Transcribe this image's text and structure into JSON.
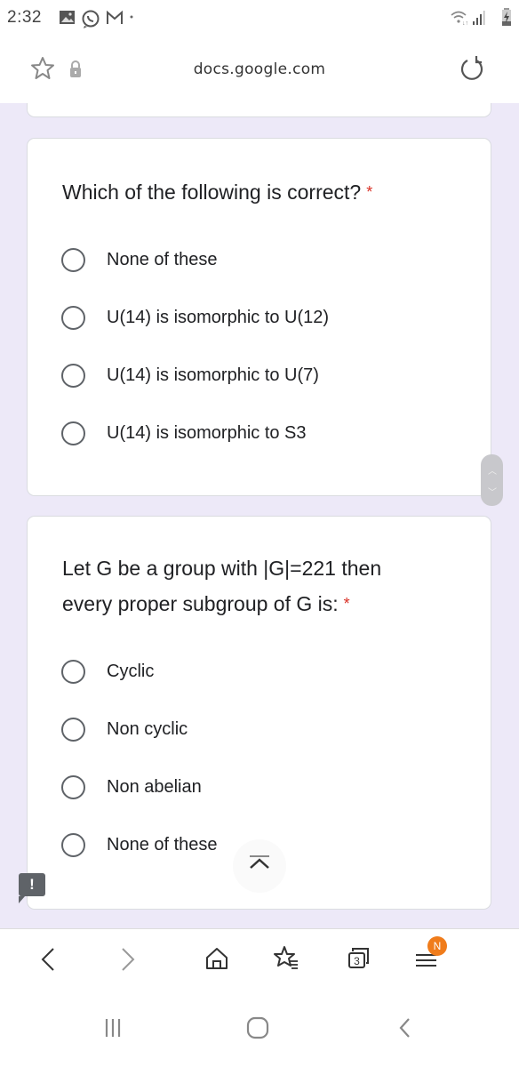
{
  "status_bar": {
    "time": "2:32",
    "left_icons": [
      "gallery-icon",
      "whatsapp-icon",
      "gmail-icon",
      "dot-icon"
    ],
    "right_icons": [
      "wifi-icon",
      "signal-icon",
      "battery-charging-icon"
    ]
  },
  "url_bar": {
    "url": "docs.google.com",
    "icons": [
      "star-icon",
      "lock-icon",
      "reload-icon"
    ]
  },
  "form": {
    "questions": [
      {
        "title": "Which of the following is correct?",
        "required_mark": "*",
        "options": [
          "None of these",
          "U(14) is isomorphic to U(12)",
          "U(14) is isomorphic to U(7)",
          "U(14) is isomorphic to S3"
        ]
      },
      {
        "title_line1": "Let G be a group with |G|=221 then",
        "title_line2": "every proper subgroup of G is:",
        "required_mark": "*",
        "options": [
          "Cyclic",
          "Non cyclic",
          "Non abelian",
          "None of these"
        ]
      }
    ],
    "feedback_label": "!"
  },
  "toolbar": {
    "tabs_count": "3",
    "menu_badge": "N",
    "badge_color": "#f07c1b",
    "buttons": [
      "back",
      "forward",
      "home",
      "bookmarks",
      "tabs",
      "menu"
    ]
  },
  "system_nav": {
    "buttons": [
      "recent-apps",
      "home",
      "back"
    ]
  }
}
